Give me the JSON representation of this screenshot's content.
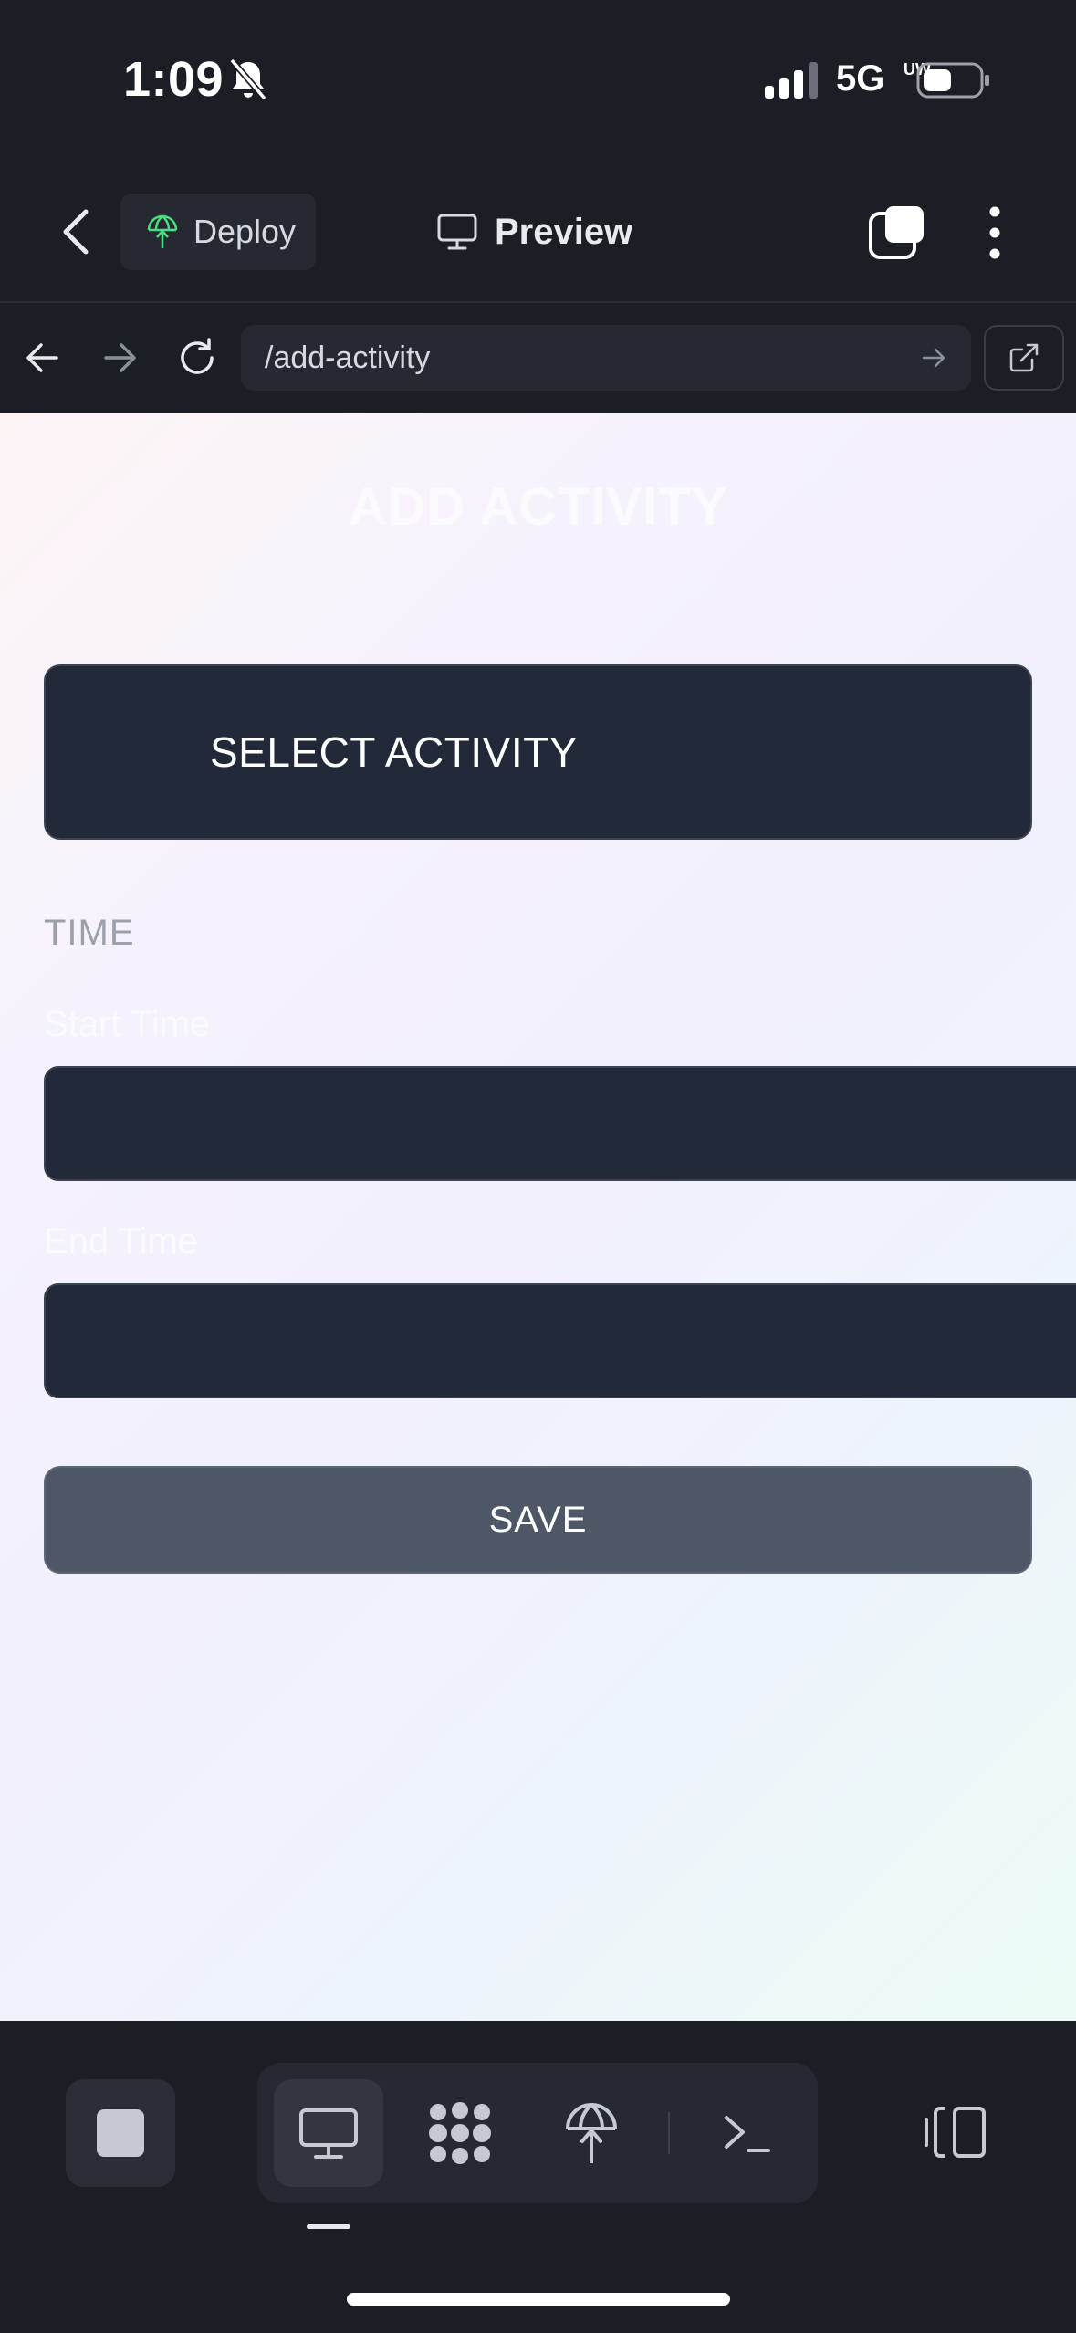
{
  "status_bar": {
    "time": "1:09",
    "network": "5G",
    "network_sub": "UW"
  },
  "toolbar": {
    "deploy_label": "Deploy",
    "preview_label": "Preview"
  },
  "browser": {
    "url": "/add-activity"
  },
  "page": {
    "title": "ADD ACTIVITY",
    "select_activity_label": "SELECT ACTIVITY",
    "time_heading": "TIME",
    "start_time_label": "Start Time",
    "end_time_label": "End Time",
    "start_time_value": "",
    "end_time_value": "",
    "save_label": "SAVE"
  },
  "bottom_toolbar": {
    "icons": [
      "stop-icon",
      "desktop-icon",
      "nodes-icon",
      "deploy-icon",
      "terminal-icon",
      "panel-icon"
    ]
  },
  "colors": {
    "app_bg": "#1c1e26",
    "surface": "#262932",
    "input_bg": "#222938",
    "save_bg": "#4e5766",
    "deploy_green": "#4ade80"
  }
}
